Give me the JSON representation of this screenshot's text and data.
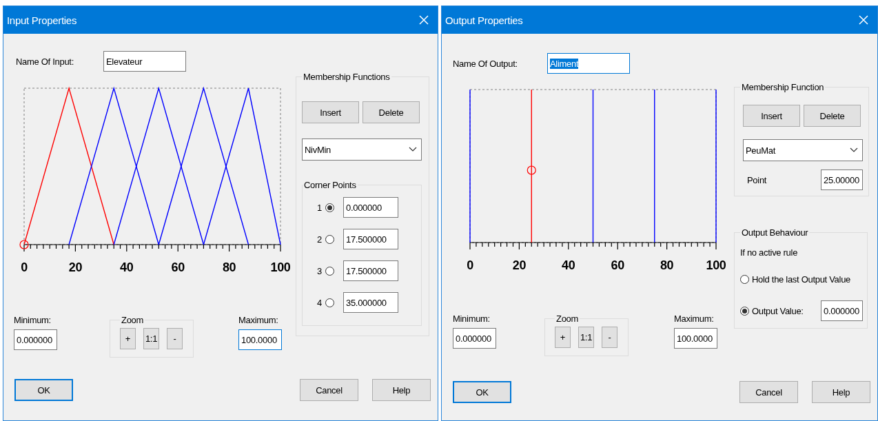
{
  "dialogs": [
    {
      "kind": "input",
      "title": "Input Properties",
      "name_label": "Name Of Input:",
      "name_value": "Elevateur",
      "name_text_selected": false,
      "chart": {
        "axis_labels": [
          "0",
          "20",
          "40",
          "60",
          "80",
          "100"
        ],
        "functions": [
          {
            "selected": true
          },
          {
            "selected": false
          },
          {
            "selected": false
          },
          {
            "selected": false
          },
          {
            "selected": false
          }
        ]
      },
      "membership": {
        "title": "Membership Functions",
        "buttons": [
          "Insert",
          "Delete"
        ],
        "dropdown_value": "NivMin",
        "corner_points": {
          "title": "Corner Points",
          "points": [
            {
              "label": "1",
              "selected": true,
              "value": "0.000000"
            },
            {
              "label": "2",
              "selected": false,
              "value": "17.500000"
            },
            {
              "label": "3",
              "selected": false,
              "value": "17.500000"
            },
            {
              "label": "4",
              "selected": false,
              "value": "35.000000"
            }
          ]
        }
      },
      "minimum": {
        "label": "Minimum:",
        "value": "0.000000",
        "focused": false
      },
      "zoom": {
        "title": "Zoom",
        "buttons": [
          "+",
          "1:1",
          "-"
        ]
      },
      "maximum": {
        "label": "Maximum:",
        "value": "100.0000",
        "focused": true
      },
      "buttons": [
        {
          "label": "OK",
          "default": true
        },
        {
          "label": "Cancel",
          "default": false
        },
        {
          "label": "Help",
          "default": false
        }
      ]
    },
    {
      "kind": "output",
      "title": "Output Properties",
      "name_label": "Name Of Output:",
      "name_value": "Aliment",
      "name_text_selected": true,
      "chart": {
        "axis_labels": [
          "0",
          "20",
          "40",
          "60",
          "80",
          "100"
        ],
        "functions": [
          {
            "selected": false
          },
          {
            "selected": true
          },
          {
            "selected": false
          },
          {
            "selected": false
          },
          {
            "selected": false
          }
        ]
      },
      "membership": {
        "title": "Membership Function",
        "buttons": [
          "Insert",
          "Delete"
        ],
        "dropdown_value": "PeuMat",
        "point_label": "Point",
        "point_value": "25.00000"
      },
      "behaviour": {
        "title": "Output Behaviour",
        "caption": "If no active rule",
        "options": [
          {
            "label": "Hold the last Output Value",
            "selected": false
          },
          {
            "label": "Output Value:",
            "selected": true,
            "value": "0.000000"
          }
        ]
      },
      "minimum": {
        "label": "Minimum:",
        "value": "0.000000",
        "focused": false
      },
      "zoom": {
        "title": "Zoom",
        "buttons": [
          "+",
          "1:1",
          "-"
        ]
      },
      "maximum": {
        "label": "Maximum:",
        "value": "100.0000",
        "focused": false
      },
      "buttons": [
        {
          "label": "OK",
          "default": true
        },
        {
          "label": "Cancel",
          "default": false
        },
        {
          "label": "Help",
          "default": false
        }
      ]
    }
  ]
}
